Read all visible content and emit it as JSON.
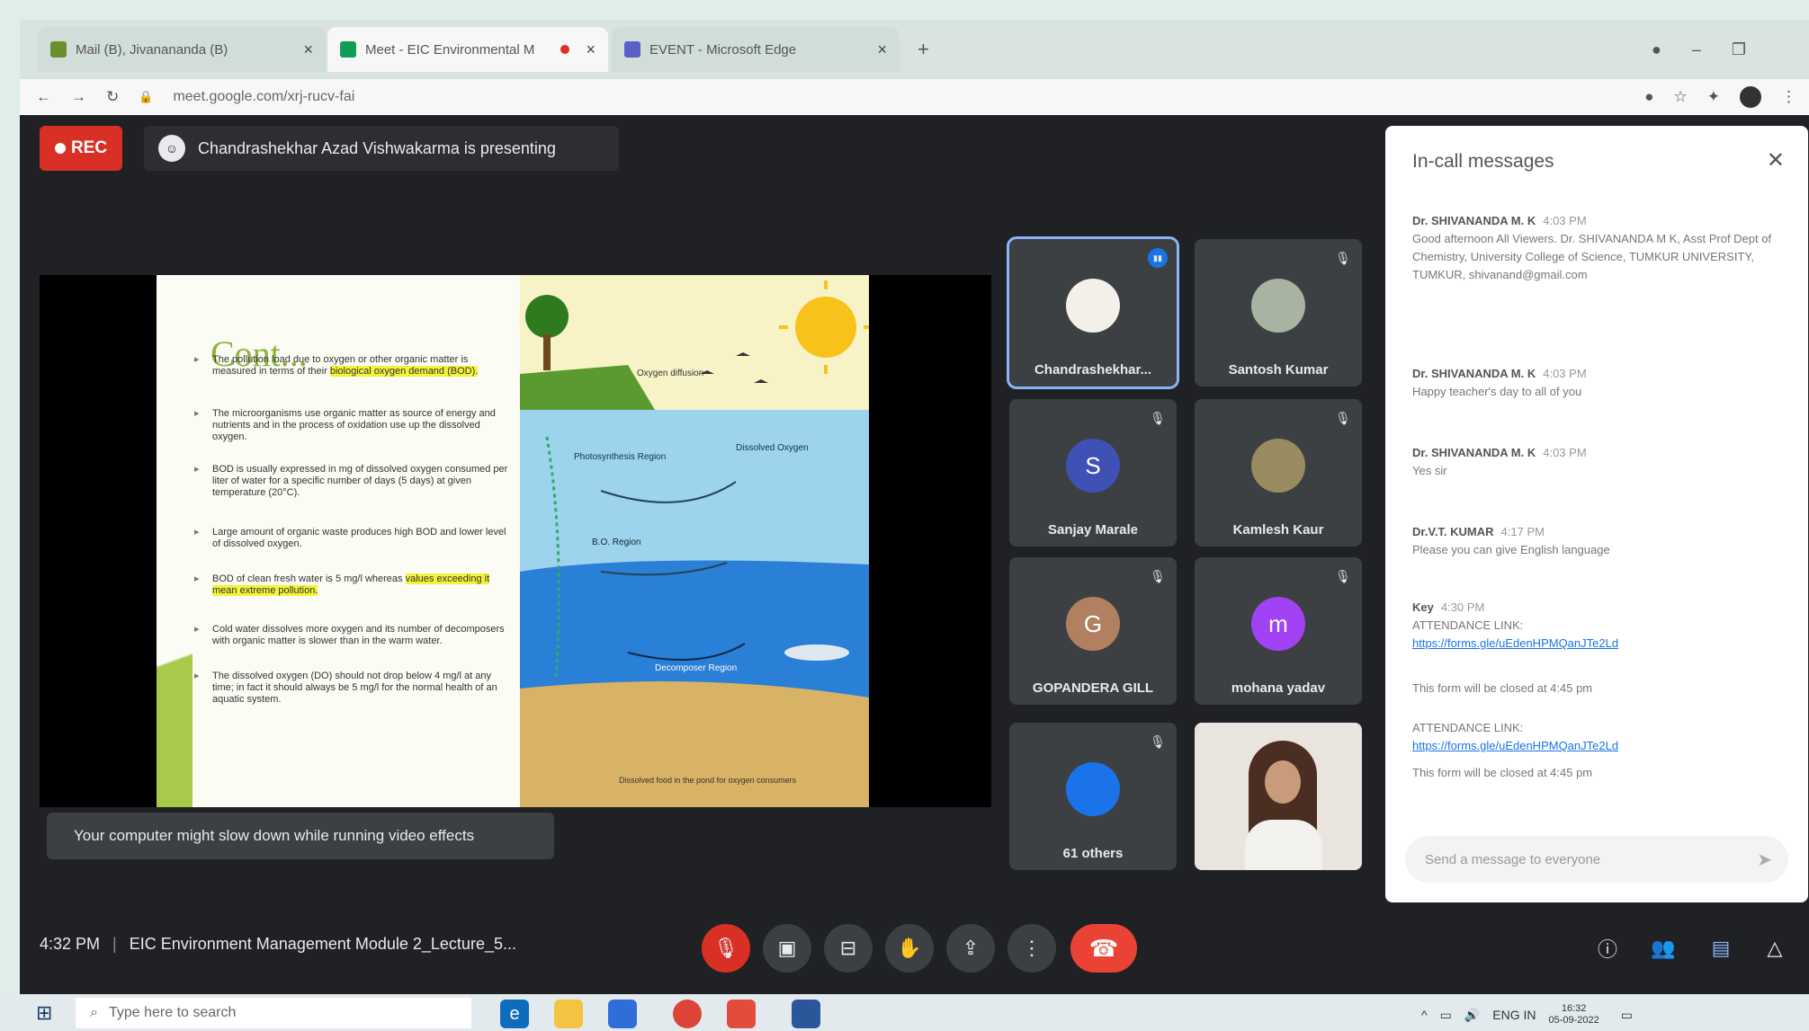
{
  "browser": {
    "tabs": [
      {
        "label": "Mail (B), Jivanananda (B)",
        "color": "#6b8f2a"
      },
      {
        "label": "Meet - EIC Environmental M",
        "color": "#0f9d58"
      },
      {
        "label": "EVENT - Microsoft Edge",
        "color": "#5b5fc7"
      }
    ],
    "new_tab": "+",
    "url": "meet.google.com/xrj-rucv-fai"
  },
  "meet": {
    "rec_label": "REC",
    "presenting_text": "Chandrashekhar Azad Vishwakarma is presenting",
    "toast": "Your computer might slow down while running video effects",
    "time": "4:32 PM",
    "meeting_title": "EIC Environment Management Module 2_Lecture_5...",
    "participants": [
      {
        "name": "Chandrashekhar...",
        "initial": "",
        "color": "#f3f0ea",
        "speaking": true
      },
      {
        "name": "Santosh Kumar",
        "initial": "",
        "color": "#a8b3a2",
        "speaking": false
      },
      {
        "name": "Sanjay Marale",
        "initial": "S",
        "color": "#3f51b5",
        "speaking": false
      },
      {
        "name": "Kamlesh Kaur",
        "initial": "",
        "color": "#9a8a5f",
        "speaking": false
      },
      {
        "name": "GOPANDERA GILL",
        "initial": "G",
        "color": "#b08060",
        "speaking": false
      },
      {
        "name": "mohana yadav",
        "initial": "m",
        "color": "#a142f4",
        "speaking": false
      },
      {
        "name": "61 others",
        "initial": "",
        "color": "#1a73e8",
        "speaking": false
      }
    ]
  },
  "slide": {
    "title": "Cont...",
    "bullets": [
      {
        "text": "The pollution load due to oxygen or other organic matter is measured in terms of their ",
        "highlight": "biological oxygen demand (BOD)."
      },
      {
        "text": "The microorganisms use organic matter as source of energy and nutrients and in the process of oxidation use up the dissolved oxygen.",
        "highlight": ""
      },
      {
        "text": "BOD is usually expressed in mg of dissolved oxygen consumed per liter of water for a specific number of days (5 days) at given temperature (20°C).",
        "highlight": ""
      },
      {
        "text": "Large amount of organic waste produces high BOD and lower level of dissolved oxygen.",
        "highlight": ""
      },
      {
        "text": "BOD of clean fresh water is 5 mg/l whereas ",
        "highlight": "values exceeding it mean extreme pollution."
      },
      {
        "text": "Cold water dissolves more oxygen and its number of decomposers with organic matter is slower than in the warm water.",
        "highlight": ""
      },
      {
        "text": "The dissolved oxygen (DO) should not drop below 4 mg/l at any time; in fact it should always be 5 mg/l for the normal health of an aquatic system.",
        "highlight": ""
      }
    ],
    "figure_labels": {
      "oxygen_diffusion": "Oxygen diffusion",
      "photosynthesis": "Photosynthesis Region",
      "dissolved_oxygen": "Dissolved Oxygen",
      "bod_region": "B.O. Region",
      "decomposer": "Decomposer Region",
      "bottom": "Dissolved food in the pond for oxygen consumers"
    }
  },
  "chat": {
    "title": "In-call messages",
    "messages": [
      {
        "author": "Dr. SHIVANANDA M. K",
        "time": "4:03 PM",
        "lines": [
          "Good afternoon All Viewers. Dr. SHIVANANDA M K, Asst Prof Dept of Chemistry, University College of Science, TUMKUR UNIVERSITY, TUMKUR, shivanand@gmail.com"
        ],
        "links": []
      },
      {
        "author": "Dr. SHIVANANDA M. K",
        "time": "4:03 PM",
        "lines": [
          "Happy teacher's day to all of you"
        ],
        "links": []
      },
      {
        "author": "Dr. SHIVANANDA M. K",
        "time": "4:03 PM",
        "lines": [
          "Yes sir"
        ],
        "links": []
      },
      {
        "author": "Dr.V.T. KUMAR",
        "time": "4:17 PM",
        "lines": [
          "Please you can give English language"
        ],
        "links": []
      },
      {
        "author": "Key",
        "time": "4:30 PM",
        "lines": [
          "ATTENDANCE LINK:"
        ],
        "links": [
          "https://forms.gle/uEdenHPMQanJTe2Ld"
        ]
      },
      {
        "author": "",
        "time": "",
        "lines": [
          "This form will be closed at 4:45 pm"
        ],
        "links": []
      },
      {
        "author": "",
        "time": "",
        "lines": [
          "ATTENDANCE LINK:"
        ],
        "links": [
          "https://forms.gle/uEdenHPMQanJTe2Ld"
        ]
      },
      {
        "author": "",
        "time": "",
        "lines": [
          "This form will be closed at 4:45 pm"
        ],
        "links": []
      }
    ],
    "input_placeholder": "Send a message to everyone"
  },
  "taskbar": {
    "search_placeholder": "Type here to search",
    "clock_time": "16:32",
    "clock_date": "05-09-2022",
    "lang": "ENG IN"
  }
}
